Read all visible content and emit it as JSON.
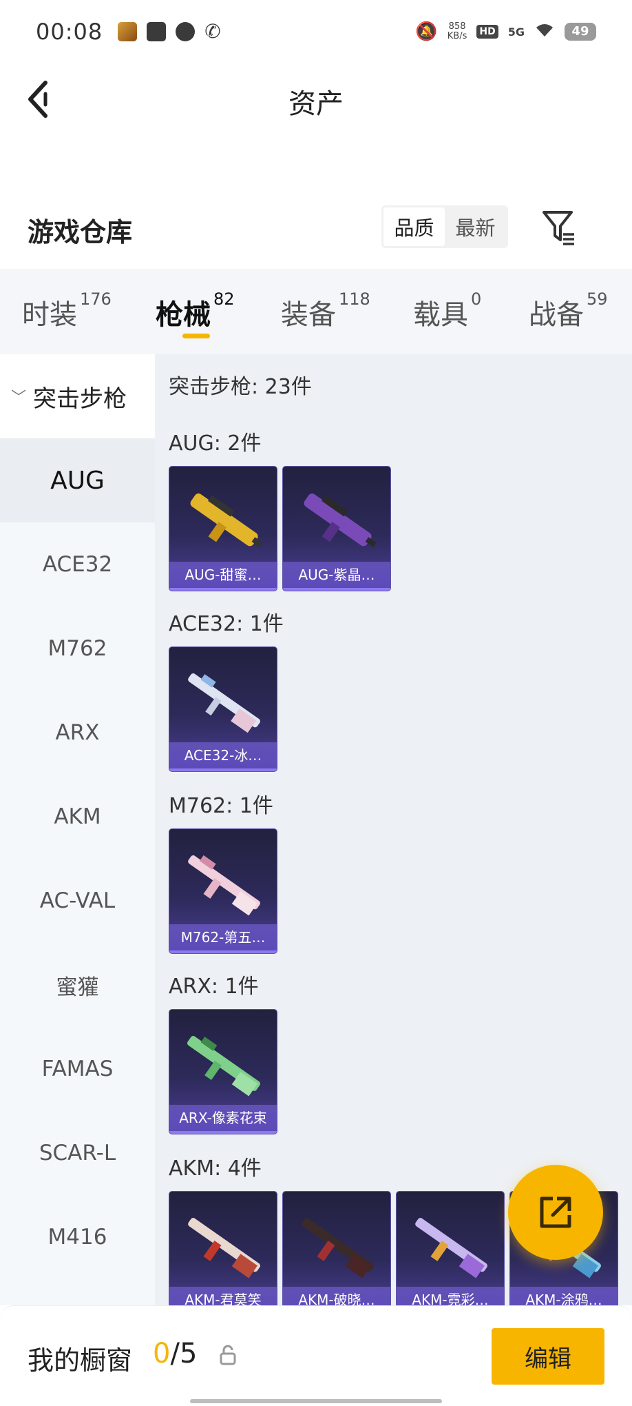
{
  "status_bar": {
    "time": "00:08",
    "speed_value": "858",
    "speed_unit": "KB/s",
    "hd": "HD",
    "network": "5G",
    "battery": "49"
  },
  "header": {
    "title": "资产"
  },
  "warehouse": {
    "title": "游戏仓库",
    "sort_options": [
      "品质",
      "最新"
    ],
    "active_sort": "品质"
  },
  "tabs": [
    {
      "label": "时装",
      "count": "176"
    },
    {
      "label": "枪械",
      "count": "82"
    },
    {
      "label": "装备",
      "count": "118"
    },
    {
      "label": "载具",
      "count": "0"
    },
    {
      "label": "战备",
      "count": "59"
    }
  ],
  "active_tab": "枪械",
  "sidebar": {
    "category": "突击步枪",
    "items": [
      "AUG",
      "ACE32",
      "M762",
      "ARX",
      "AKM",
      "AC-VAL",
      "蜜獾",
      "FAMAS",
      "SCAR-L",
      "M416"
    ],
    "active_item": "AUG"
  },
  "content": {
    "summary": "突击步枪: 23件",
    "groups": [
      {
        "label": "AUG: 2件",
        "items": [
          "AUG-甜蜜…",
          "AUG-紫晶…"
        ]
      },
      {
        "label": "ACE32: 1件",
        "items": [
          "ACE32-冰…"
        ]
      },
      {
        "label": "M762: 1件",
        "items": [
          "M762-第五…"
        ]
      },
      {
        "label": "ARX: 1件",
        "items": [
          "ARX-像素花束"
        ]
      },
      {
        "label": "AKM: 4件",
        "items": [
          "AKM-君莫笑",
          "AKM-破晓…",
          "AKM-霓彩…",
          "AKM-涂鸦…"
        ]
      }
    ]
  },
  "bottom": {
    "showcase_label": "我的橱窗",
    "showcase_current": "0",
    "showcase_sep": "/",
    "showcase_total": "5",
    "edit_label": "编辑"
  },
  "colors": {
    "accent": "#f7b500",
    "card_bg": "#2d2a5a",
    "card_name_bar": "#5b49b8"
  }
}
